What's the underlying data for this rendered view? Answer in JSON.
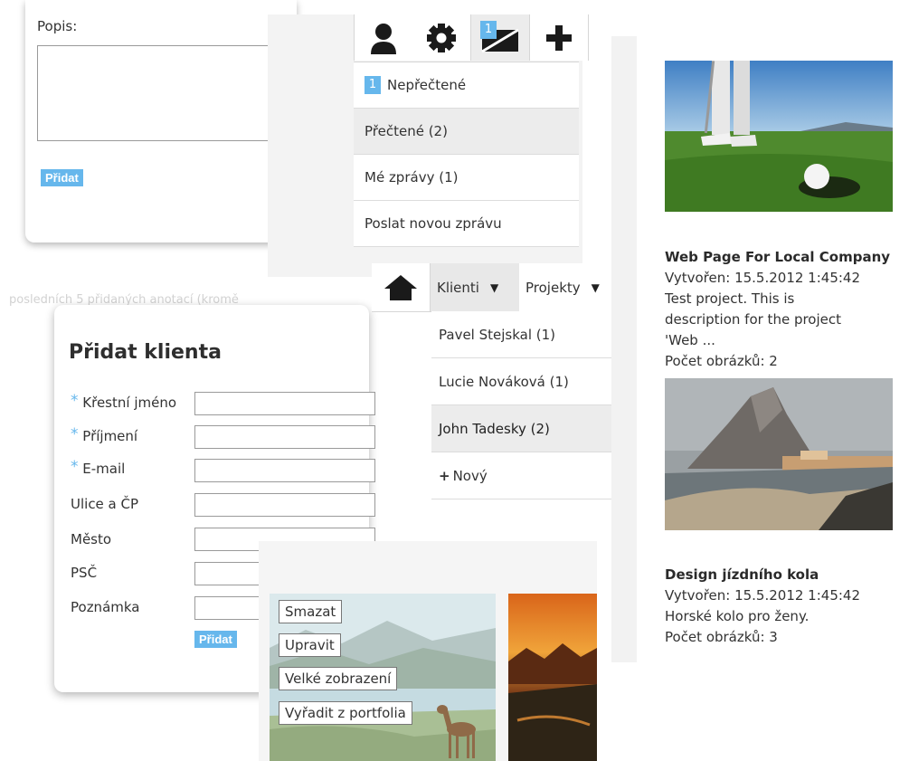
{
  "description_form": {
    "label": "Popis:",
    "textarea_value": "",
    "add_button": "Přidat"
  },
  "faded_text": "posledních 5 přidaných anotací (kromě",
  "client_form": {
    "title": "Přidat klienta",
    "required_mark": "*",
    "fields": {
      "first_name": "Křestní jméno",
      "last_name": "Příjmení",
      "email": "E-mail",
      "street": "Ulice a ČP",
      "city": "Město",
      "zip": "PSČ",
      "note": "Poznámka"
    },
    "add_button": "Přidat"
  },
  "top_icons": {
    "user": "user-icon",
    "settings": "gear-icon",
    "messages": "envelope-icon",
    "messages_badge": "1",
    "add": "plus-icon"
  },
  "message_menu": {
    "unread_count": "1",
    "unread": "Nepřečtené",
    "read": "Přečtené (2)",
    "mine": "Mé zprávy (1)",
    "send_new": "Poslat novou zprávu"
  },
  "clients_nav": {
    "home": "home-icon",
    "tab_clients": "Klienti",
    "tab_projects": "Projekty",
    "caret": "▼",
    "items": [
      "Pavel Stejskal (1)",
      "Lucie Nováková (1)",
      "John Tadesky (2)"
    ],
    "new_plus": "+",
    "new_label": "Nový"
  },
  "portfolio_actions": {
    "delete": "Smazat",
    "edit": "Upravit",
    "large_view": "Velké zobrazení",
    "remove": "Vyřadit z portfolia"
  },
  "projects": [
    {
      "title": "Web Page For Local Company",
      "created": "Vytvořen: 15.5.2012 1:45:42",
      "desc_line1": "Test project. This is",
      "desc_line2": "description for the project",
      "desc_line3": "'Web ...",
      "images": "Počet obrázků: 2"
    },
    {
      "title": "Design jízdního kola",
      "created": "Vytvořen: 15.5.2012 1:45:42",
      "desc_line1": "Horské kolo pro ženy.",
      "images": "Počet obrázků: 3"
    }
  ],
  "colors": {
    "accent": "#66b7ec",
    "active_row": "#ececec",
    "icon": "#1a1a1a"
  }
}
